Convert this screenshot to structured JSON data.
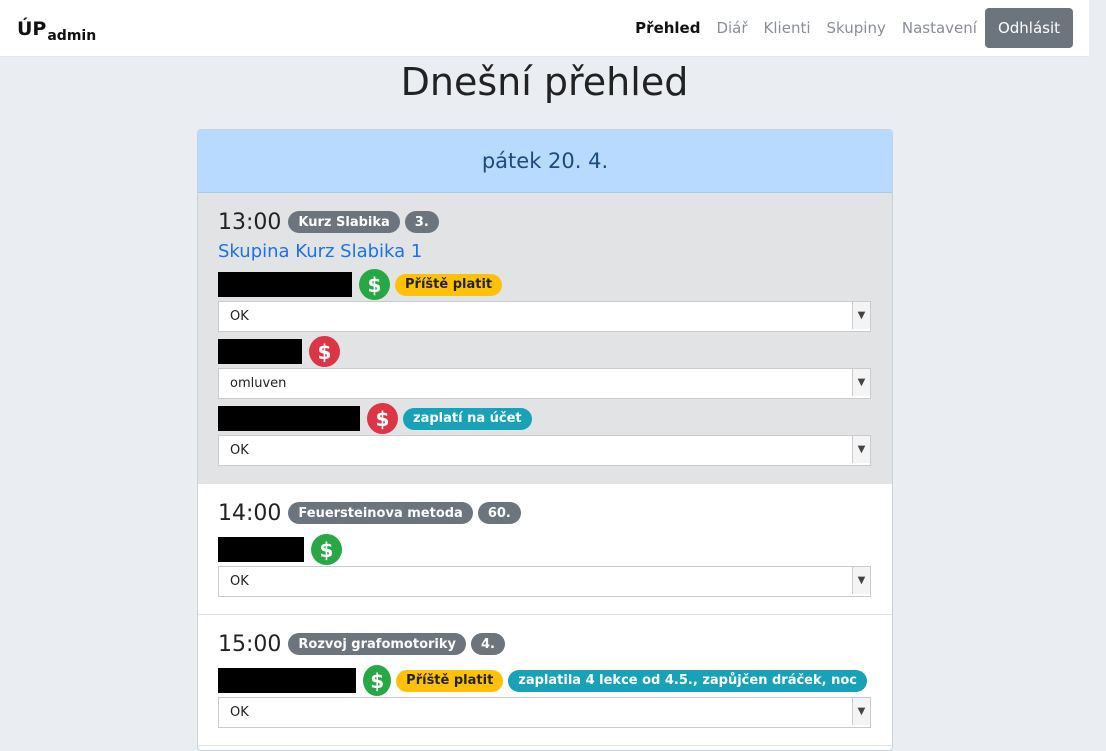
{
  "navbar": {
    "brand_main": "ÚP",
    "brand_sub": "admin",
    "links": [
      "Přehled",
      "Diář",
      "Klienti",
      "Skupiny",
      "Nastavení"
    ],
    "logout_label": "Odhlásit"
  },
  "page_title": "Dnešní přehled",
  "day": {
    "header": "pátek 20. 4."
  },
  "lessons": [
    {
      "time": "13:00",
      "course": "Kurz Slabika",
      "number": "3.",
      "group": "Skupina Kurz Slabika 1",
      "clients": [
        {
          "payment_icon": "dollar-icon-green",
          "badges": [
            "Příště platit"
          ],
          "status": "OK"
        },
        {
          "payment_icon": "dollar-icon-red",
          "badges": [],
          "status": "omluven"
        },
        {
          "payment_icon": "dollar-icon-red",
          "badges": [
            "zaplatí na účet"
          ],
          "status": "OK"
        }
      ]
    },
    {
      "time": "14:00",
      "course": "Feuersteinova metoda",
      "number": "60.",
      "clients": [
        {
          "payment_icon": "dollar-icon-green",
          "badges": [],
          "status": "OK"
        }
      ]
    },
    {
      "time": "15:00",
      "course": "Rozvoj grafomotoriky",
      "number": "4.",
      "clients": [
        {
          "payment_icon": "dollar-icon-green",
          "badges": [
            "Příště platit",
            "zaplatila 4 lekce od 4.5., zapůjčen dráček, noc"
          ],
          "status": "OK"
        }
      ]
    }
  ],
  "colors": {
    "accent_header": "#b8daff",
    "active_lesson_bg": "#e2e3e5",
    "paid": "#28a745",
    "unpaid": "#dc3545",
    "warning_badge": "#ffc107",
    "info_badge": "#17a2b8"
  }
}
